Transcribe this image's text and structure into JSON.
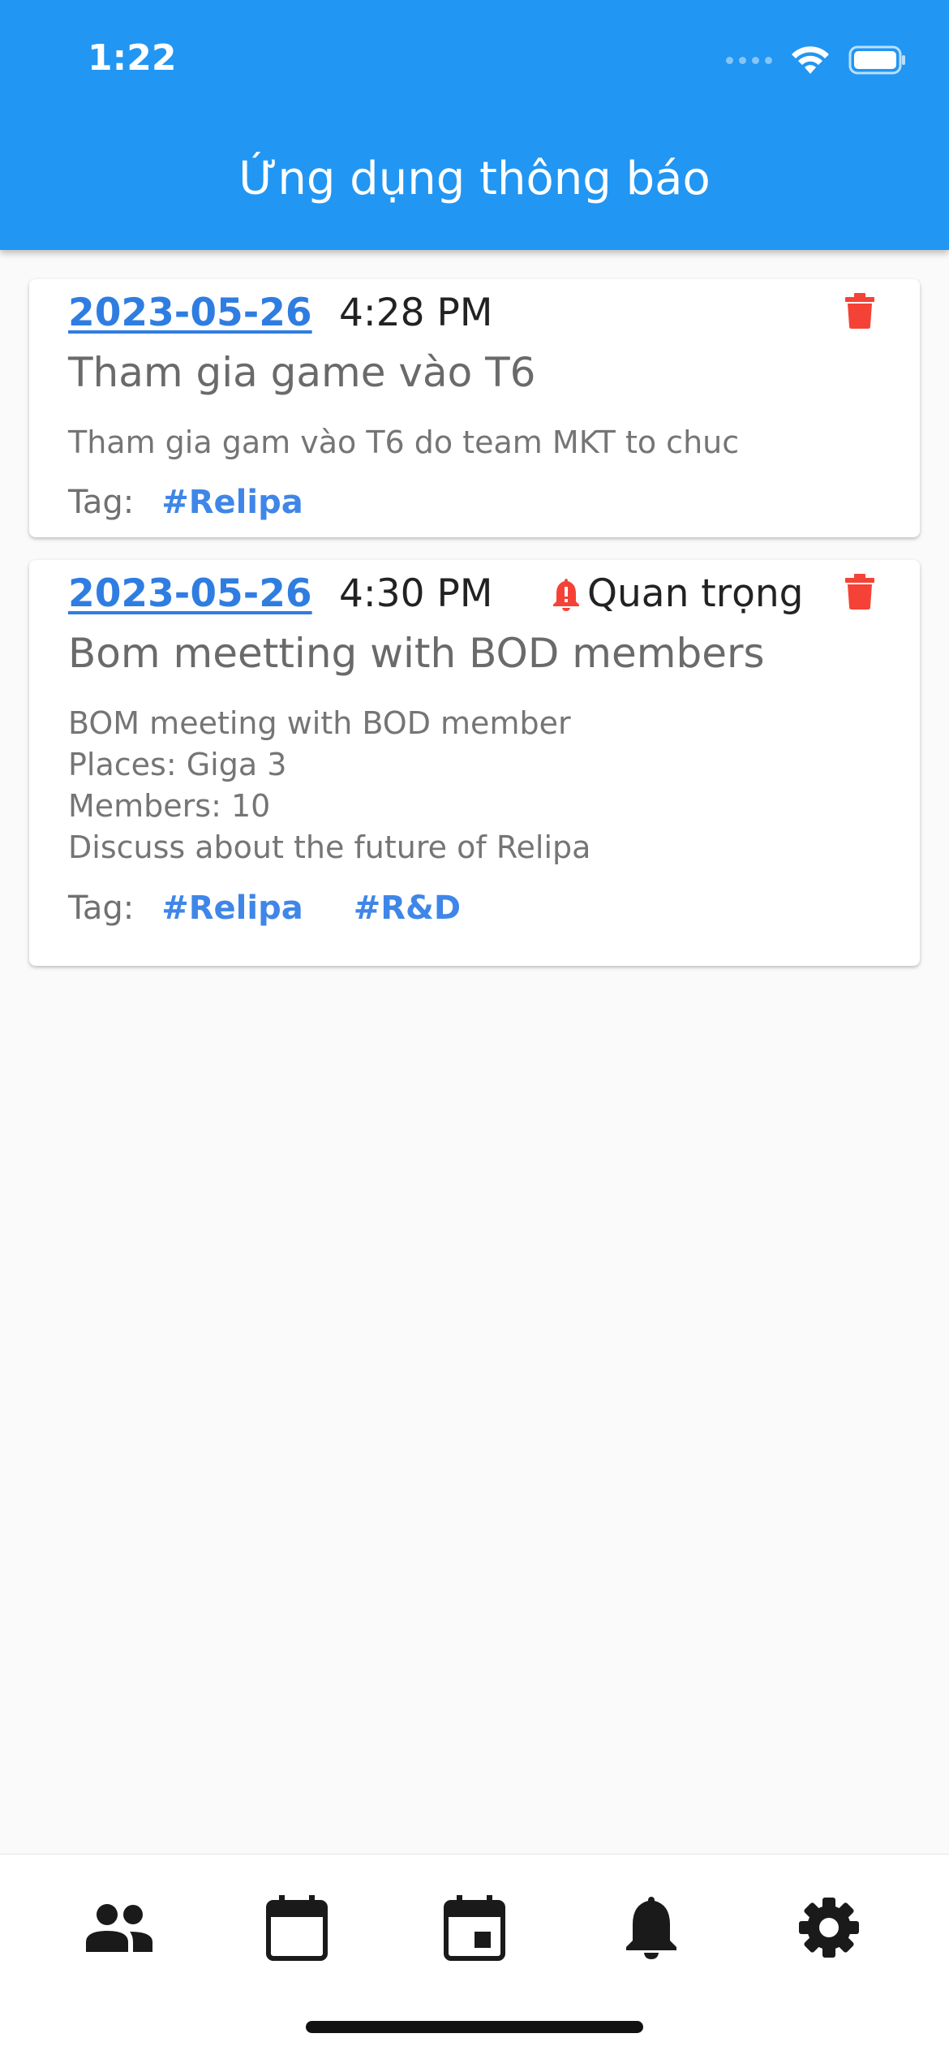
{
  "status_bar": {
    "time": "1:22"
  },
  "appbar": {
    "title": "Ứng dụng thông báo"
  },
  "notifications": [
    {
      "date": "2023-05-26",
      "time": "4:28 PM",
      "title": "Tham gia game vào T6",
      "body": [
        "Tham gia gam vào T6 do team MKT to chuc"
      ],
      "tag_label": "Tag:",
      "tags": [
        "#Relipa"
      ]
    },
    {
      "date": "2023-05-26",
      "time": "4:30 PM",
      "important_label": "Quan trọng",
      "title": "Bom meetting with BOD members",
      "body": [
        "BOM meeting with BOD member",
        "Places: Giga 3",
        "Members: 10",
        "Discuss about the future of Relipa"
      ],
      "tag_label": "Tag:",
      "tags": [
        "#Relipa",
        "#R&D"
      ]
    }
  ],
  "bottom_nav": [
    "people-icon",
    "calendar-icon",
    "calendar-event-icon",
    "bell-icon",
    "gear-icon"
  ],
  "colors": {
    "primary": "#2196f3",
    "link": "#2f7de1",
    "danger": "#f44336"
  }
}
